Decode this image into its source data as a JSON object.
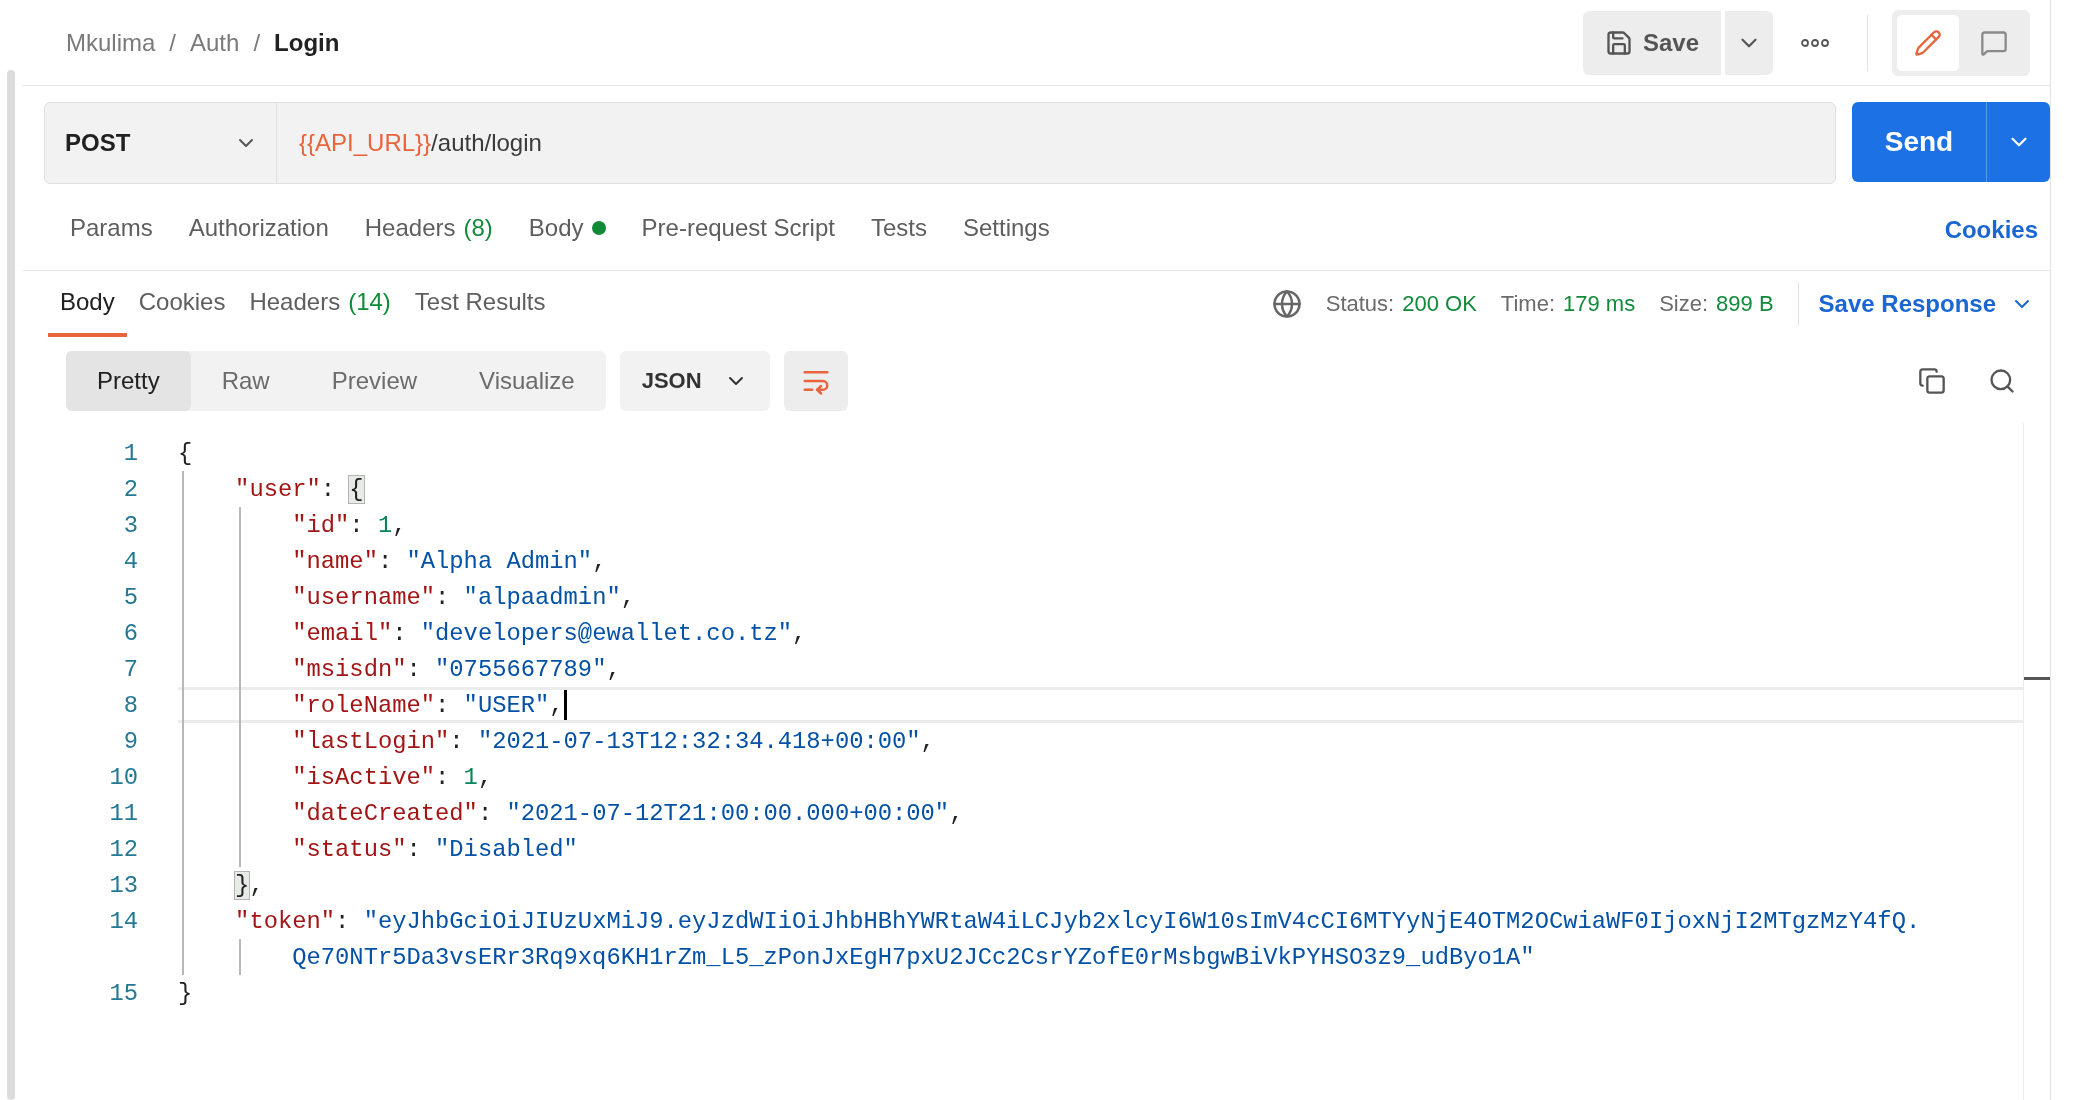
{
  "breadcrumb": [
    {
      "kind": "link",
      "text": "Mkulima"
    },
    {
      "kind": "separator",
      "text": "/"
    },
    {
      "kind": "link",
      "text": "Auth"
    },
    {
      "kind": "separator",
      "text": "/"
    },
    {
      "kind": "current",
      "text": "Login"
    }
  ],
  "header_actions": {
    "save": "Save",
    "modes": [
      {
        "kind": "edit",
        "selected": true
      },
      {
        "kind": "comments",
        "selected": false
      }
    ]
  },
  "request": {
    "method": "POST",
    "url": [
      {
        "kind": "variable",
        "text": "{{API_URL}}"
      },
      {
        "kind": "path",
        "text": "/auth/login"
      }
    ],
    "send": "Send"
  },
  "request_tabs": [
    {
      "label": "Params",
      "selected": false
    },
    {
      "label": "Authorization",
      "selected": false
    },
    {
      "label": "Headers",
      "count": "(8)",
      "selected": false
    },
    {
      "label": "Body",
      "has_content": true,
      "selected": false
    },
    {
      "label": "Pre-request Script",
      "selected": false
    },
    {
      "label": "Tests",
      "selected": false
    },
    {
      "label": "Settings",
      "selected": false
    }
  ],
  "cookies_link": "Cookies",
  "response_tabs": [
    {
      "label": "Body",
      "selected": true
    },
    {
      "label": "Cookies",
      "selected": false
    },
    {
      "label": "Headers",
      "count": "(14)",
      "selected": false
    },
    {
      "label": "Test Results",
      "selected": false
    }
  ],
  "response_meta": [
    {
      "label": "Status:",
      "value": "200 OK"
    },
    {
      "label": "Time:",
      "value": "179 ms"
    },
    {
      "label": "Size:",
      "value": "899 B"
    }
  ],
  "save_response": "Save Response",
  "view_modes": [
    {
      "label": "Pretty",
      "selected": true
    },
    {
      "label": "Raw",
      "selected": false
    },
    {
      "label": "Preview",
      "selected": false
    },
    {
      "label": "Visualize",
      "selected": false
    }
  ],
  "format": "JSON",
  "wrap_lines": true,
  "code_lines": [
    {
      "number": "1",
      "tokens": [
        {
          "kind": "open",
          "text": "{"
        }
      ]
    },
    {
      "number": "2",
      "tokens": [
        {
          "kind": "key",
          "text": "\"user\""
        },
        {
          "kind": "punct",
          "text": ": "
        },
        {
          "kind": "open",
          "text": "{",
          "matched": true
        }
      ]
    },
    {
      "number": "3",
      "tokens": [
        {
          "kind": "key",
          "text": "\"id\""
        },
        {
          "kind": "punct",
          "text": ": "
        },
        {
          "kind": "num",
          "text": "1"
        },
        {
          "kind": "punct",
          "text": ","
        }
      ]
    },
    {
      "number": "4",
      "tokens": [
        {
          "kind": "key",
          "text": "\"name\""
        },
        {
          "kind": "punct",
          "text": ": "
        },
        {
          "kind": "str",
          "text": "\"Alpha Admin\""
        },
        {
          "kind": "punct",
          "text": ","
        }
      ]
    },
    {
      "number": "5",
      "tokens": [
        {
          "kind": "key",
          "text": "\"username\""
        },
        {
          "kind": "punct",
          "text": ": "
        },
        {
          "kind": "str",
          "text": "\"alpaadmin\""
        },
        {
          "kind": "punct",
          "text": ","
        }
      ]
    },
    {
      "number": "6",
      "tokens": [
        {
          "kind": "key",
          "text": "\"email\""
        },
        {
          "kind": "punct",
          "text": ": "
        },
        {
          "kind": "str",
          "text": "\"developers@ewallet.co.tz\""
        },
        {
          "kind": "punct",
          "text": ","
        }
      ]
    },
    {
      "number": "7",
      "tokens": [
        {
          "kind": "key",
          "text": "\"msisdn\""
        },
        {
          "kind": "punct",
          "text": ": "
        },
        {
          "kind": "str",
          "text": "\"0755667789\""
        },
        {
          "kind": "punct",
          "text": ","
        }
      ]
    },
    {
      "number": "8",
      "current": true,
      "tokens": [
        {
          "kind": "key",
          "text": "\"roleName\""
        },
        {
          "kind": "punct",
          "text": ": "
        },
        {
          "kind": "str",
          "text": "\"USER\""
        },
        {
          "kind": "punct",
          "text": ","
        }
      ]
    },
    {
      "number": "9",
      "tokens": [
        {
          "kind": "key",
          "text": "\"lastLogin\""
        },
        {
          "kind": "punct",
          "text": ": "
        },
        {
          "kind": "str",
          "text": "\"2021-07-13T12:32:34.418+00:00\""
        },
        {
          "kind": "punct",
          "text": ","
        }
      ]
    },
    {
      "number": "10",
      "tokens": [
        {
          "kind": "key",
          "text": "\"isActive\""
        },
        {
          "kind": "punct",
          "text": ": "
        },
        {
          "kind": "num",
          "text": "1"
        },
        {
          "kind": "punct",
          "text": ","
        }
      ]
    },
    {
      "number": "11",
      "tokens": [
        {
          "kind": "key",
          "text": "\"dateCreated\""
        },
        {
          "kind": "punct",
          "text": ": "
        },
        {
          "kind": "str",
          "text": "\"2021-07-12T21:00:00.000+00:00\""
        },
        {
          "kind": "punct",
          "text": ","
        }
      ]
    },
    {
      "number": "12",
      "tokens": [
        {
          "kind": "key",
          "text": "\"status\""
        },
        {
          "kind": "punct",
          "text": ": "
        },
        {
          "kind": "str",
          "text": "\"Disabled\""
        }
      ]
    },
    {
      "number": "13",
      "tokens": [
        {
          "kind": "close",
          "text": "}",
          "matched": true
        },
        {
          "kind": "punct",
          "text": ","
        }
      ]
    },
    {
      "number": "14",
      "tokens": [
        {
          "kind": "key",
          "text": "\"token\""
        },
        {
          "kind": "punct",
          "text": ": "
        },
        {
          "kind": "str",
          "text": "\"eyJhbGciOiJIUzUxMiJ9.eyJzdWIiOiJhbHBhYWRtaW4iLCJyb2xlcyI6W10sImV4cCI6MTYyNjE4OTM2OCwiaWF0IjoxNjI2MTgzMzY4fQ."
        }
      ],
      "continuation": [
        {
          "kind": "str",
          "text": "Qe70NTr5Da3vsERr3Rq9xq6KH1rZm_L5_zPonJxEgH7pxU2JCc2CsrYZofE0rMsbgwBiVkPYHSO3z9_udByo1A\""
        }
      ]
    },
    {
      "number": "15",
      "tokens": [
        {
          "kind": "close",
          "text": "}"
        }
      ]
    }
  ]
}
